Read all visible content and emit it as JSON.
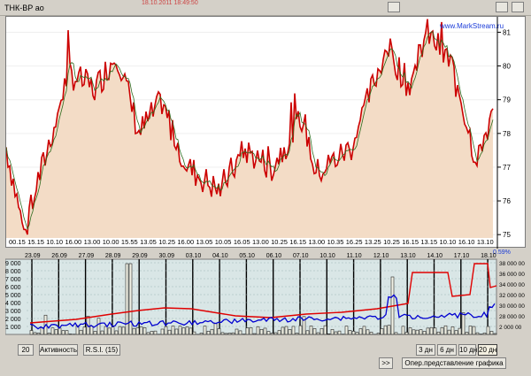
{
  "window": {
    "title": "ТНК-ВР ао",
    "top_fragment": "18.10.2011 18:49:50"
  },
  "price_chart": {
    "watermark": "www.MarkStream.ru",
    "percent_label": "0.59%",
    "y_ticks": [
      "81",
      "80",
      "79",
      "78",
      "77",
      "76",
      "75"
    ],
    "y_values": [
      81,
      80,
      79,
      78,
      77,
      76,
      75
    ],
    "x_ticks": [
      "00.15",
      "15.15",
      "10.10",
      "16.00",
      "13.00",
      "10.00",
      "15.55",
      "13.05",
      "10.25",
      "16.00",
      "13.05",
      "10.05",
      "16.05",
      "13.00",
      "10.25",
      "16.15",
      "13.00",
      "10.35",
      "16.25",
      "13.25",
      "10.25",
      "16.15",
      "13.15",
      "10.10",
      "16.10",
      "13.10"
    ]
  },
  "volume_chart": {
    "date_ticks": [
      "23.09",
      "26.09",
      "27.09",
      "28.09",
      "29.09",
      "30.09",
      "03.10",
      "04.10",
      "05.10",
      "06.10",
      "07.10",
      "10.10",
      "11.10",
      "12.10",
      "13.10",
      "14.10",
      "17.10",
      "18.10"
    ],
    "left_ticks": [
      "9 000",
      "8 000",
      "7 000",
      "6 000",
      "5 000",
      "4 000",
      "3 000",
      "2 000",
      "1 000"
    ],
    "right_ticks": [
      "38 000 00",
      "36 000 00",
      "34 000 00",
      "32 000 00",
      "30 000 00",
      "28 000 00",
      "2 000 00"
    ]
  },
  "controls": {
    "period_value": "20",
    "activity_button": "Активность",
    "rsi_button": "R.S.I.  (15)",
    "scroll_button": ">>",
    "range_3d": "3 дн",
    "range_6d": "6 дн",
    "range_10d": "10 дн",
    "range_20d": "20 дн",
    "oper_button": "Опер.представление графика"
  },
  "colors": {
    "price_line": "#cc0000",
    "price_fill": "#f3dcc6",
    "ma_line": "#2e6b1e",
    "volume_red": "#e00000",
    "volume_blue": "#0000d0",
    "panel_bg": "#d9e6e6"
  }
}
